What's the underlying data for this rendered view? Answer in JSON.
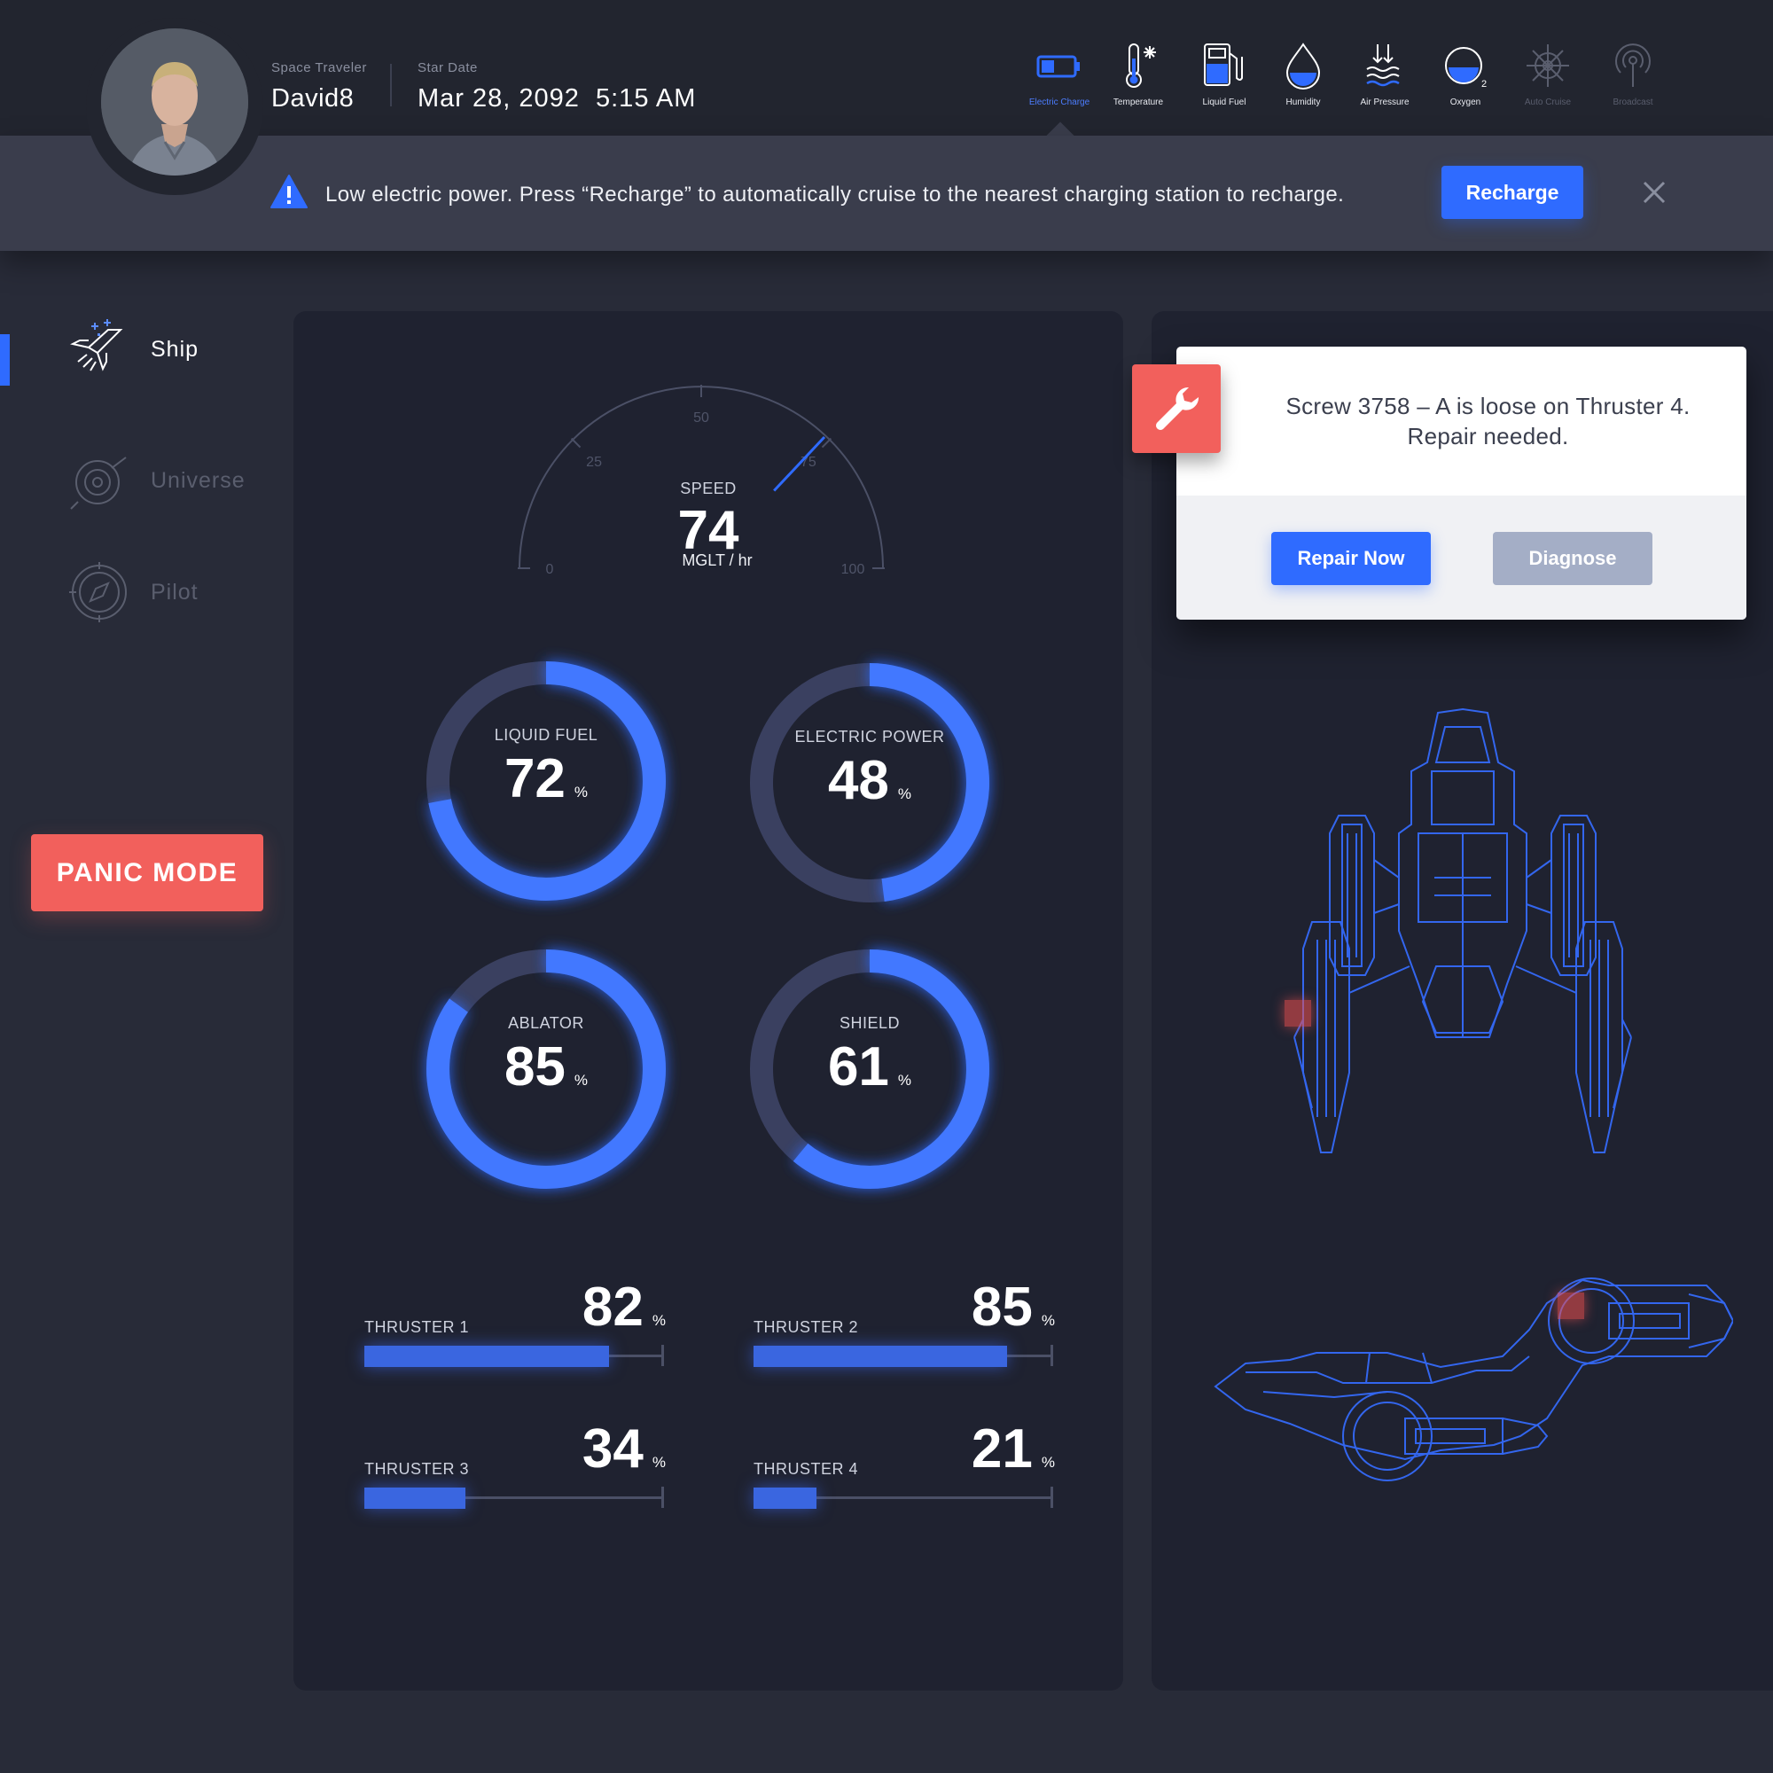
{
  "header": {
    "traveler_label": "Space Traveler",
    "traveler_name": "David8",
    "date_label": "Star Date",
    "date_value": "Mar 28, 2092  5:15 AM",
    "nav": [
      {
        "label": "Electric Charge",
        "icon": "battery-icon",
        "state": "active"
      },
      {
        "label": "Temperature",
        "icon": "thermometer-icon",
        "state": "normal"
      },
      {
        "label": "Liquid Fuel",
        "icon": "fuel-pump-icon",
        "state": "normal"
      },
      {
        "label": "Humidity",
        "icon": "water-drop-icon",
        "state": "normal"
      },
      {
        "label": "Air Pressure",
        "icon": "air-pressure-icon",
        "state": "normal"
      },
      {
        "label": "Oxygen",
        "icon": "oxygen-icon",
        "state": "normal"
      },
      {
        "label": "Auto Cruise",
        "icon": "ship-wheel-icon",
        "state": "disabled"
      },
      {
        "label": "Broadcast",
        "icon": "broadcast-icon",
        "state": "disabled"
      }
    ]
  },
  "alert": {
    "message": "Low electric power. Press “Recharge” to automatically cruise to the nearest charging station to recharge.",
    "action_label": "Recharge"
  },
  "sidebar": {
    "items": [
      {
        "label": "Ship",
        "icon": "space-shuttle-icon",
        "active": true
      },
      {
        "label": "Universe",
        "icon": "planet-orbit-icon",
        "active": false
      },
      {
        "label": "Pilot",
        "icon": "compass-icon",
        "active": false
      }
    ],
    "panic_label": "PANIC MODE"
  },
  "speed": {
    "label": "SPEED",
    "value": 74,
    "unit": "MGLT / hr",
    "min": 0,
    "max": 100,
    "ticks": [
      "0",
      "25",
      "50",
      "75",
      "100"
    ]
  },
  "gauges": [
    {
      "label": "LIQUID FUEL",
      "value": 72,
      "unit": "%"
    },
    {
      "label": "ELECTRIC POWER",
      "value": 48,
      "unit": "%"
    },
    {
      "label": "ABLATOR",
      "value": 85,
      "unit": "%"
    },
    {
      "label": "SHIELD",
      "value": 61,
      "unit": "%"
    }
  ],
  "thrusters": [
    {
      "label": "THRUSTER 1",
      "value": 82,
      "unit": "%"
    },
    {
      "label": "THRUSTER 2",
      "value": 85,
      "unit": "%"
    },
    {
      "label": "THRUSTER 3",
      "value": 34,
      "unit": "%"
    },
    {
      "label": "THRUSTER 4",
      "value": 21,
      "unit": "%"
    }
  ],
  "repair": {
    "message_line1": "Screw 3758 – A is loose on Thruster 4.",
    "message_line2": "Repair needed.",
    "primary_label": "Repair Now",
    "secondary_label": "Diagnose"
  },
  "colors": {
    "accent": "#2f6bff",
    "danger": "#f2605c",
    "background": "#282b38",
    "panel": "#1f2230"
  }
}
